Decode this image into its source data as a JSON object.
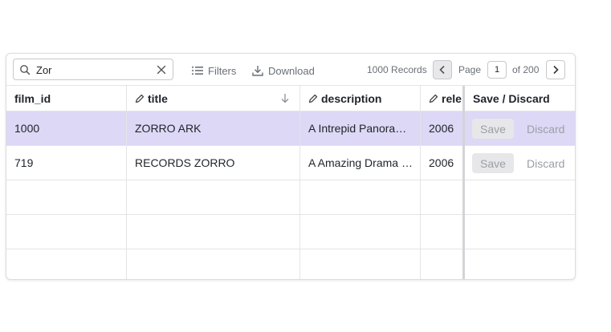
{
  "toolbar": {
    "search_value": "Zor",
    "filters_label": "Filters",
    "download_label": "Download",
    "records_label": "1000 Records",
    "page_label": "Page",
    "page_value": "1",
    "of_label": "of 200"
  },
  "columns": {
    "film_id": "film_id",
    "title": "title",
    "description": "description",
    "release": "rele",
    "actions": "Save / Discard"
  },
  "rows": [
    {
      "film_id": "1000",
      "title": "ZORRO ARK",
      "description": "A Intrepid Panorama of a Mad Scientist",
      "release": "2006",
      "save": "Save",
      "discard": "Discard"
    },
    {
      "film_id": "719",
      "title": "RECORDS ZORRO",
      "description": "A Amazing Drama of a Mad Scientist",
      "release": "2006",
      "save": "Save",
      "discard": "Discard"
    }
  ],
  "colors": {
    "selected_row": "#dcd8f6",
    "border": "#e4e4e7",
    "muted_text": "#6b6f76"
  }
}
